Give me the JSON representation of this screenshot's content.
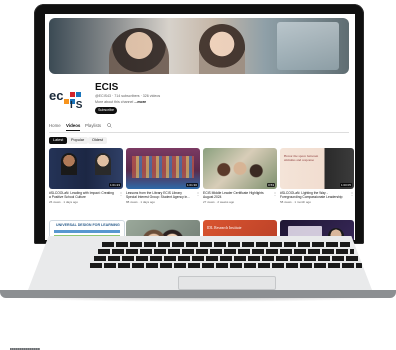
{
  "channel": {
    "name": "ECIS",
    "meta": "@ECIS43 · 714 subscribers · 326 videos",
    "about_prefix": "More about this channel ",
    "about_more": "...more",
    "subscribe_label": "Subscribe",
    "logo": {
      "left": "ec",
      "right": "IS"
    }
  },
  "tabs": [
    {
      "label": "Home"
    },
    {
      "label": "Videos"
    },
    {
      "label": "Playlists"
    }
  ],
  "filters": [
    {
      "label": "Latest"
    },
    {
      "label": "Popular"
    },
    {
      "label": "Oldest"
    }
  ],
  "videos": [
    {
      "title": "#SLCOOLaN: Leading with Impact: Creating",
      "title2": "a Positive School Culture",
      "meta": "26 views · 1 days ago",
      "duration": "1:01:23",
      "thumb_bg": "#1f2c48"
    },
    {
      "title": "Lessons from the Library ECIS Library",
      "title2": "Special Interest Group: Student Agency in...",
      "meta": "88 views · 1 days ago",
      "duration": "1:01:30",
      "thumb_bg": "#6d2f5a"
    },
    {
      "title": "ECIS Middle Leader Certificate Highlights",
      "title2": "August 2024",
      "meta": "27 views · 2 weeks ago",
      "duration": "0:53",
      "thumb_bg": "#4c6b4a"
    },
    {
      "title": "#SLCOOLaN: Lighting the Way -",
      "title2": "Foregrounding Compassionate Leadership",
      "meta": "58 views · 1 month ago",
      "duration": "1:00:05",
      "thumb_bg": "#f1ddd0"
    },
    {
      "title": "",
      "title2": "",
      "meta": "",
      "duration": "",
      "thumb_bg": "#3a6f9e"
    },
    {
      "title": "",
      "title2": "",
      "meta": "",
      "duration": "",
      "thumb_bg": "#5c5f62"
    },
    {
      "title": "",
      "title2": "",
      "meta": "",
      "duration": "",
      "thumb_bg": "#c84a2b"
    },
    {
      "title": "",
      "title2": "",
      "meta": "",
      "duration": "",
      "thumb_bg": "#241a3b"
    }
  ],
  "thumb_texts": {
    "v4": "Honor the space between stimulus and response",
    "v5": "UNIVERSAL DESIGN FOR LEARNING",
    "v7": "IDL Research Institute"
  }
}
